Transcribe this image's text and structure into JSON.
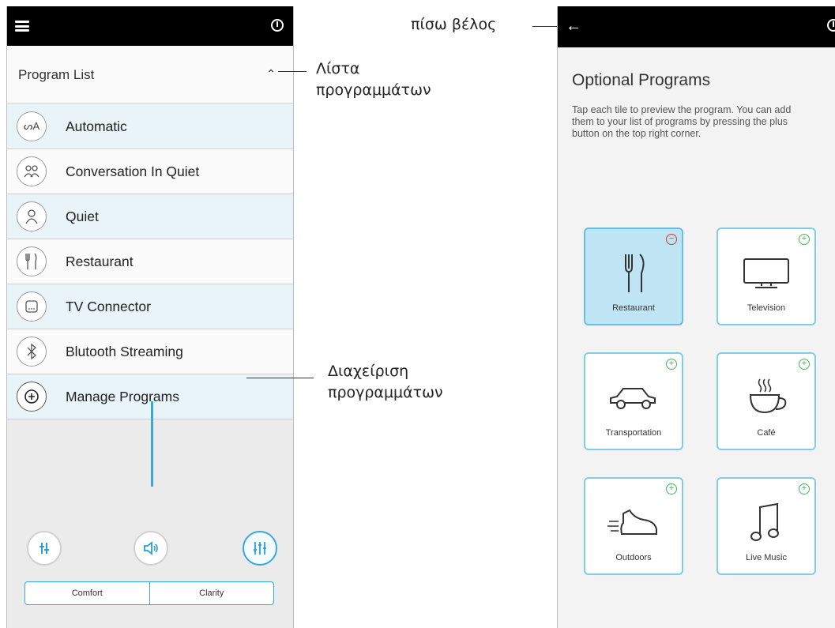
{
  "left_phone": {
    "section_title": "Program List",
    "programs": [
      {
        "label": "Automatic",
        "icon": "automatic-icon"
      },
      {
        "label": "Conversation In Quiet",
        "icon": "conversation-icon"
      },
      {
        "label": "Quiet",
        "icon": "quiet-icon"
      },
      {
        "label": "Restaurant",
        "icon": "fork-knife-icon"
      },
      {
        "label": "TV Connector",
        "icon": "tv-connector-icon"
      },
      {
        "label": "Blutooth Streaming",
        "icon": "bluetooth-icon"
      },
      {
        "label": "Manage Programs",
        "icon": "plus-circle-icon"
      }
    ],
    "controls": {
      "mode_a": "Comfort",
      "mode_b": "Clarity"
    }
  },
  "annotations": {
    "program_list": [
      "Λίστα",
      "προγραμμάτων"
    ],
    "manage_programs": [
      "Διαχείριση",
      "προγραμμάτων"
    ],
    "back_arrow": "πίσω βέλος"
  },
  "right_phone": {
    "title": "Optional Programs",
    "description": "Tap each tile to preview the program. You can add them to your list of programs by pressing the plus button on the top right corner.",
    "tiles": [
      {
        "label": "Restaurant",
        "icon": "fork-knife-icon",
        "badge": "remove",
        "selected": true
      },
      {
        "label": "Television",
        "icon": "television-icon",
        "badge": "add",
        "selected": false
      },
      {
        "label": "Transportation",
        "icon": "car-icon",
        "badge": "add",
        "selected": false
      },
      {
        "label": "Café",
        "icon": "coffee-cup-icon",
        "badge": "add",
        "selected": false
      },
      {
        "label": "Outdoors",
        "icon": "shoe-icon",
        "badge": "add",
        "selected": false
      },
      {
        "label": "Live Music",
        "icon": "music-note-icon",
        "badge": "add",
        "selected": false
      }
    ]
  },
  "colors": {
    "accent": "#3aa7d8",
    "tile_selected": "#bfe5f4",
    "add_badge": "#3cba5a",
    "remove_badge": "#d9333b"
  }
}
